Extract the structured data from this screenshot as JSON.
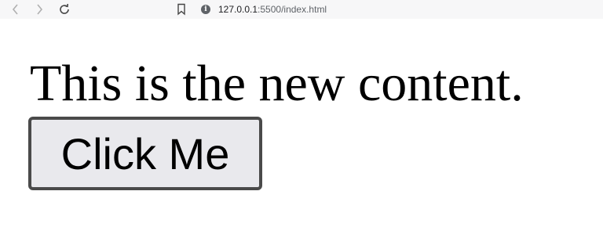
{
  "browser": {
    "url_host": "127.0.0.1",
    "url_path": ":5500/index.html",
    "icons": [
      "chevron-left-icon",
      "chevron-right-icon",
      "reload-icon",
      "bookmark-icon",
      "info-icon"
    ]
  },
  "page": {
    "headline": "This is the new content.",
    "button_label": "Click Me"
  },
  "colors": {
    "toolbar_bg": "#f7f7f8",
    "button_bg": "#e9e9ed",
    "button_border": "#4a4a4a",
    "text": "#000000"
  }
}
